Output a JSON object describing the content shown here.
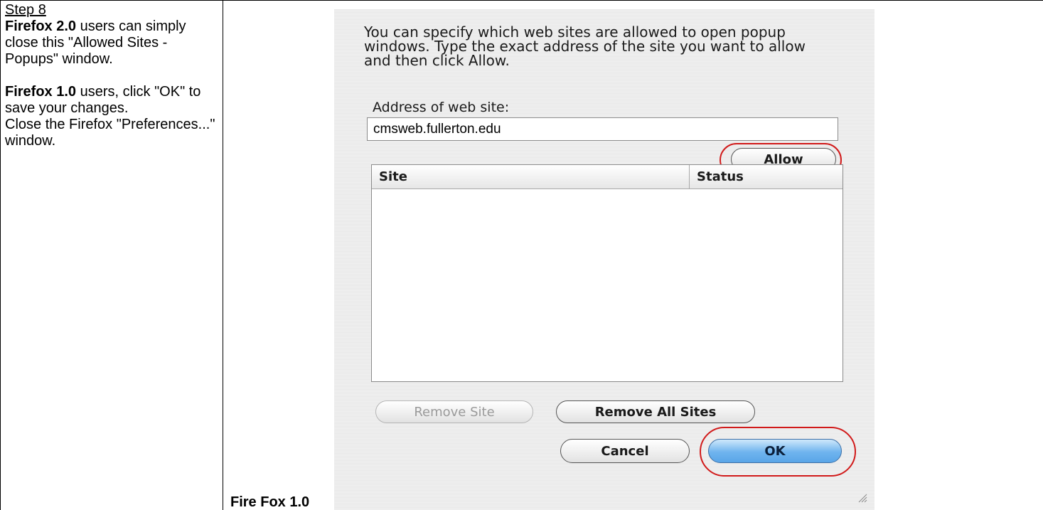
{
  "instructions": {
    "step_label": "Step 8",
    "ff2_bold": "Firefox 2.0",
    "ff2_text": " users can simply close this \"Allowed Sites - Popups\" window.",
    "ff1_bold": "Firefox 1.0",
    "ff1_text": " users, click \"OK\" to save your changes.",
    "close_text": "Close the Firefox \"Preferences...\" window."
  },
  "caption": "Fire Fox 1.0",
  "dialog": {
    "intro_text": "You can specify which web sites are allowed to open popup windows. Type the exact address of the site you want to allow and then click Allow.",
    "address_label": "Address of web site:",
    "address_value": "cmsweb.fullerton.edu",
    "allow_button": "Allow",
    "table": {
      "columns": [
        "Site",
        "Status"
      ],
      "rows": []
    },
    "remove_site_button": "Remove Site",
    "remove_all_button": "Remove All Sites",
    "cancel_button": "Cancel",
    "ok_button": "OK",
    "highlight_color": "#d11a1a"
  }
}
